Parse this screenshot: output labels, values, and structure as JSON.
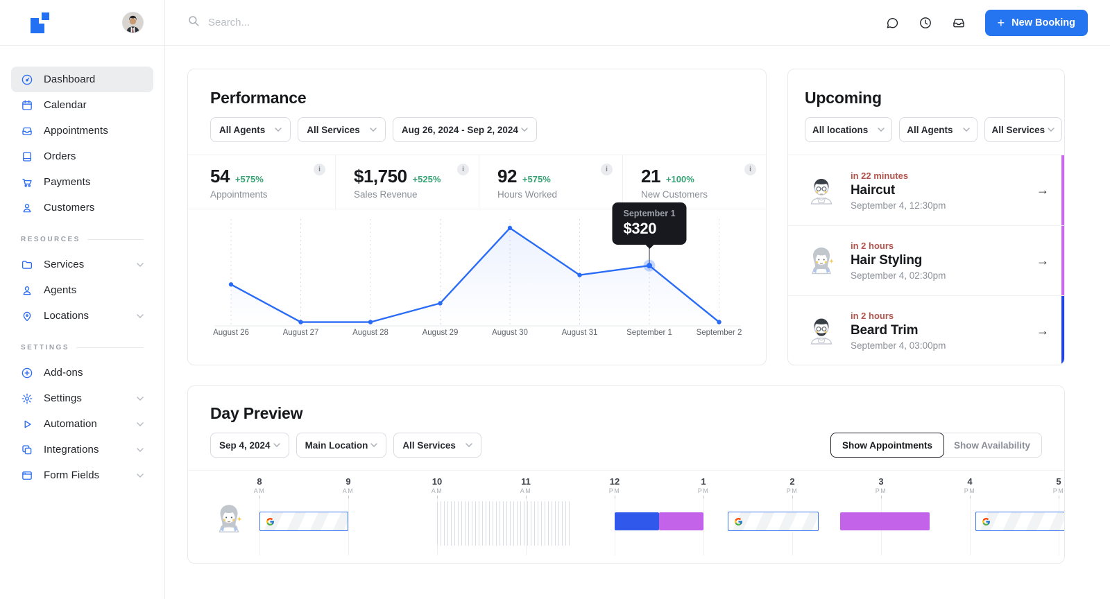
{
  "colors": {
    "accent_blue": "#2b6cf2",
    "button_blue": "#2574f0",
    "positive_green": "#36a273",
    "eta_red": "#b3544d",
    "event_blue": "#3058ea",
    "event_purple": "#c263ea",
    "strip_purple": "#cb68e8",
    "strip_blue": "#2243df",
    "tooltip_bg": "#17191e"
  },
  "topbar": {
    "search_placeholder": "Search...",
    "icons": [
      "chat-icon",
      "clock-icon",
      "inbox-icon"
    ],
    "new_booking_label": "New Booking",
    "new_booking_plus": "+"
  },
  "sidebar": {
    "sections": [
      {
        "header": null,
        "items": [
          {
            "icon": "dashboard",
            "label": "Dashboard",
            "active": true,
            "chevron": false
          },
          {
            "icon": "calendar",
            "label": "Calendar",
            "active": false,
            "chevron": false
          },
          {
            "icon": "appointments",
            "label": "Appointments",
            "active": false,
            "chevron": false
          },
          {
            "icon": "orders",
            "label": "Orders",
            "active": false,
            "chevron": false
          },
          {
            "icon": "payments",
            "label": "Payments",
            "active": false,
            "chevron": false
          },
          {
            "icon": "customers",
            "label": "Customers",
            "active": false,
            "chevron": false
          }
        ]
      },
      {
        "header": "RESOURCES",
        "items": [
          {
            "icon": "services",
            "label": "Services",
            "active": false,
            "chevron": true
          },
          {
            "icon": "agents",
            "label": "Agents",
            "active": false,
            "chevron": false
          },
          {
            "icon": "locations",
            "label": "Locations",
            "active": false,
            "chevron": true
          }
        ]
      },
      {
        "header": "SETTINGS",
        "items": [
          {
            "icon": "addons",
            "label": "Add-ons",
            "active": false,
            "chevron": false
          },
          {
            "icon": "settings",
            "label": "Settings",
            "active": false,
            "chevron": true
          },
          {
            "icon": "automation",
            "label": "Automation",
            "active": false,
            "chevron": true
          },
          {
            "icon": "integrations",
            "label": "Integrations",
            "active": false,
            "chevron": true
          },
          {
            "icon": "formfields",
            "label": "Form Fields",
            "active": false,
            "chevron": true
          }
        ]
      }
    ]
  },
  "performance": {
    "title": "Performance",
    "filters": [
      "All Agents",
      "All Services",
      "Aug 26, 2024 - Sep 2, 2024"
    ],
    "stats": [
      {
        "value": "54",
        "delta": "+575%",
        "label": "Appointments"
      },
      {
        "value": "$1,750",
        "delta": "+525%",
        "label": "Sales Revenue"
      },
      {
        "value": "92",
        "delta": "+575%",
        "label": "Hours Worked"
      },
      {
        "value": "21",
        "delta": "+100%",
        "label": "New Customers"
      }
    ]
  },
  "chart_data": {
    "type": "line",
    "title": "Performance – daily sales revenue",
    "x": [
      "August 26",
      "August 27",
      "August 28",
      "August 29",
      "August 30",
      "August 31",
      "September 1",
      "September 2"
    ],
    "values": [
      220,
      20,
      20,
      120,
      520,
      270,
      320,
      20
    ],
    "values_note": "estimated from pixel heights; September 1 labeled $320 by tooltip",
    "ylim": [
      0,
      560
    ],
    "grid": "vertical-dashed",
    "legend": "none",
    "line_color": "#2b6cf6",
    "tooltip": {
      "index": 6,
      "title": "September 1",
      "value": "$320"
    }
  },
  "upcoming": {
    "title": "Upcoming",
    "filters": [
      "All locations",
      "All Agents",
      "All Services"
    ],
    "items": [
      {
        "eta": "in 22 minutes",
        "service": "Haircut",
        "datetime": "September 4, 12:30pm",
        "avatar": "man-a",
        "accent": "#cb68e8",
        "arrow": "→"
      },
      {
        "eta": "in 2 hours",
        "service": "Hair Styling",
        "datetime": "September 4, 02:30pm",
        "avatar": "woman",
        "accent": "#cb68e8",
        "arrow": "→"
      },
      {
        "eta": "in 2 hours",
        "service": "Beard Trim",
        "datetime": "September 4, 03:00pm",
        "avatar": "man-b",
        "accent": "#2243df",
        "arrow": "→"
      }
    ]
  },
  "day_preview": {
    "title": "Day Preview",
    "filters": [
      "Sep 4, 2024",
      "Main Location",
      "All Services"
    ],
    "toggle": {
      "active": "Show Appointments",
      "inactive": "Show Availability"
    },
    "agent_avatar": "woman",
    "hours": [
      {
        "h": "8",
        "m": "AM"
      },
      {
        "h": "9",
        "m": "AM"
      },
      {
        "h": "10",
        "m": "AM"
      },
      {
        "h": "11",
        "m": "AM"
      },
      {
        "h": "12",
        "m": "PM"
      },
      {
        "h": "1",
        "m": "PM"
      },
      {
        "h": "2",
        "m": "PM"
      },
      {
        "h": "3",
        "m": "PM"
      },
      {
        "h": "4",
        "m": "PM"
      },
      {
        "h": "5",
        "m": "PM"
      }
    ],
    "events": [
      {
        "kind": "google",
        "start": 0,
        "end": 1,
        "name": "google-calendar-block"
      },
      {
        "kind": "busy",
        "start": 2,
        "end": 3.5,
        "name": "busy-hatched-block"
      },
      {
        "kind": "solid",
        "color": "#3058ea",
        "start": 4,
        "end": 4.5,
        "name": "appointment-blue"
      },
      {
        "kind": "solid",
        "color": "#c263ea",
        "start": 4.5,
        "end": 5,
        "name": "appointment-purple"
      },
      {
        "kind": "google",
        "start": 5.27,
        "end": 6.3,
        "name": "google-calendar-block"
      },
      {
        "kind": "solid",
        "color": "#c263ea",
        "start": 6.54,
        "end": 7.55,
        "name": "appointment-purple"
      },
      {
        "kind": "google",
        "start": 8.06,
        "end": 9.07,
        "name": "google-calendar-block"
      }
    ]
  }
}
